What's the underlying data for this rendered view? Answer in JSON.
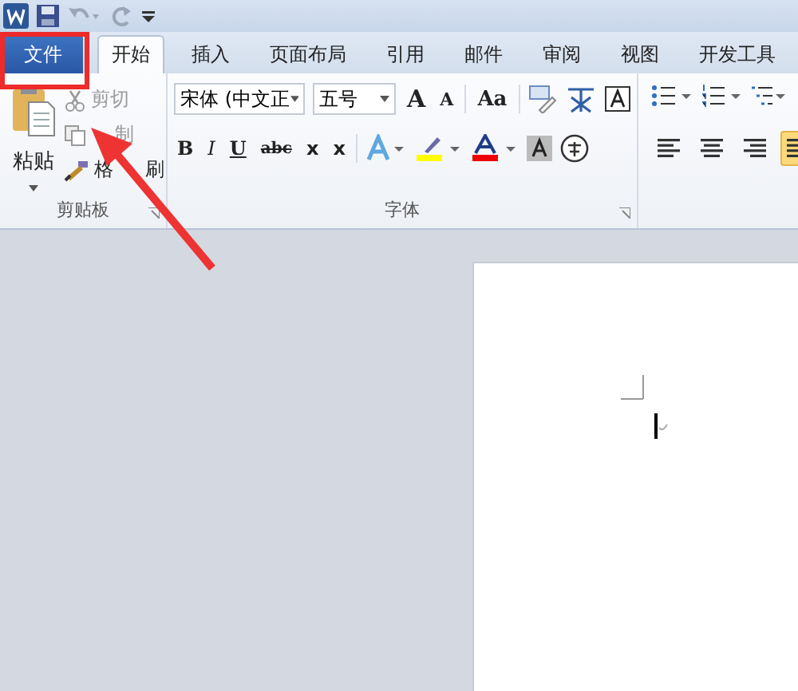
{
  "tabs": [
    {
      "label": "文件",
      "kind": "file",
      "selected": false
    },
    {
      "label": "开始",
      "kind": "tab",
      "selected": true
    },
    {
      "label": "插入",
      "kind": "tab",
      "selected": false
    },
    {
      "label": "页面布局",
      "kind": "tab",
      "selected": false
    },
    {
      "label": "引用",
      "kind": "tab",
      "selected": false
    },
    {
      "label": "邮件",
      "kind": "tab",
      "selected": false
    },
    {
      "label": "审阅",
      "kind": "tab",
      "selected": false
    },
    {
      "label": "视图",
      "kind": "tab",
      "selected": false
    },
    {
      "label": "开发工具",
      "kind": "tab",
      "selected": false
    }
  ],
  "clipboard": {
    "paste": "粘贴",
    "cut": "剪切",
    "copy": "制",
    "format_painter": [
      "格",
      "刷"
    ],
    "group_label": "剪贴板"
  },
  "font": {
    "name": "宋体 (中文正",
    "size": "五号",
    "grow": "A",
    "shrink": "A",
    "case": "Aa",
    "group_label": "字体",
    "styles": [
      {
        "label": "B",
        "kind": "bold"
      },
      {
        "label": "I",
        "kind": "italic"
      },
      {
        "label": "U",
        "kind": "underline"
      },
      {
        "label": "abc",
        "kind": "strike"
      },
      {
        "label": "x",
        "kind": "sub"
      },
      {
        "label": "x",
        "kind": "sup"
      }
    ]
  },
  "paragraph": {
    "align": [
      {
        "kind": "left",
        "selected": false
      },
      {
        "kind": "center",
        "selected": false
      },
      {
        "kind": "right",
        "selected": false
      },
      {
        "kind": "justify",
        "selected": true
      }
    ]
  }
}
